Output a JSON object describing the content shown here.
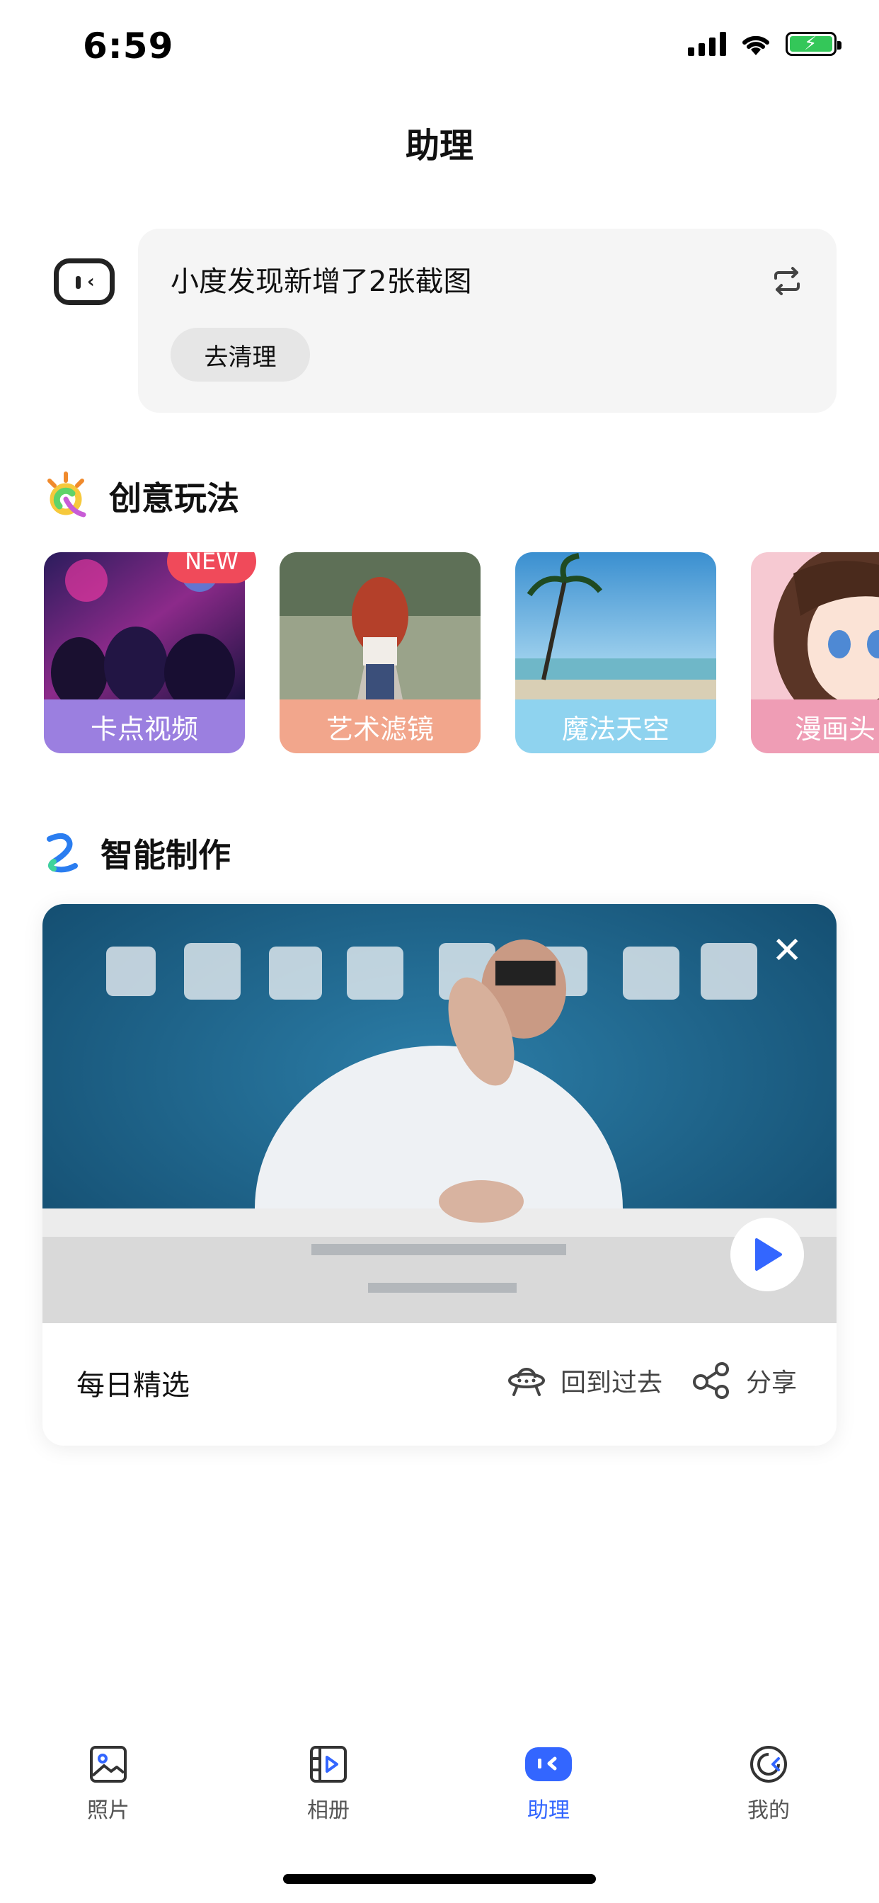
{
  "status_bar": {
    "time": "6:59"
  },
  "header": {
    "title": "助理"
  },
  "assistant": {
    "message": "小度发现新增了2张截图",
    "action_label": "去清理"
  },
  "creative": {
    "title": "创意玩法",
    "badge": "NEW",
    "items": [
      {
        "label": "卡点视频",
        "color": "#9b7fe0"
      },
      {
        "label": "艺术滤镜",
        "color": "#f2a68c"
      },
      {
        "label": "魔法天空",
        "color": "#8fd3ef"
      },
      {
        "label": "漫画头",
        "color": "#ef9db5"
      }
    ]
  },
  "smart": {
    "title": "智能制作",
    "video_footer": {
      "title": "每日精选",
      "back_label": "回到过去",
      "share_label": "分享"
    }
  },
  "tabbar": {
    "items": [
      {
        "label": "照片"
      },
      {
        "label": "相册"
      },
      {
        "label": "助理"
      },
      {
        "label": "我的"
      }
    ],
    "active_color": "#3366ff"
  }
}
